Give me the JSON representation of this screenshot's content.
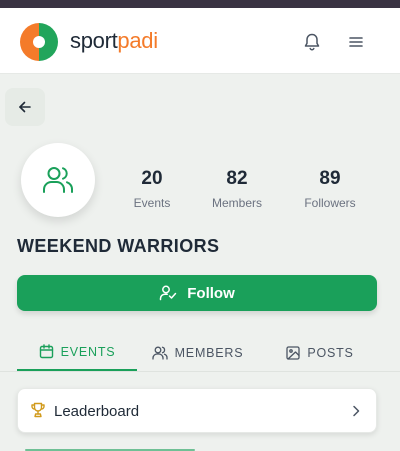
{
  "brand": {
    "part1": "sport",
    "part2": "padi"
  },
  "header": {
    "notifications_icon": "bell-icon",
    "menu_icon": "hamburger-menu-icon"
  },
  "group": {
    "name": "WEEKEND WARRIORS",
    "avatar_icon": "users-group-icon",
    "stats": [
      {
        "value": "20",
        "label": "Events"
      },
      {
        "value": "82",
        "label": "Members"
      },
      {
        "value": "89",
        "label": "Followers"
      }
    ]
  },
  "follow": {
    "label": "Follow",
    "icon": "user-check-icon"
  },
  "tabs": [
    {
      "label": "EVENTS",
      "icon": "calendar-icon",
      "active": true
    },
    {
      "label": "MEMBERS",
      "icon": "users-icon",
      "active": false
    },
    {
      "label": "POSTS",
      "icon": "image-icon",
      "active": false
    }
  ],
  "leaderboard": {
    "label": "Leaderboard",
    "icon": "trophy-icon"
  },
  "colors": {
    "accent_green": "#1aa05a",
    "brand_orange": "#f47b2a",
    "text_dark": "#1f2a37"
  }
}
